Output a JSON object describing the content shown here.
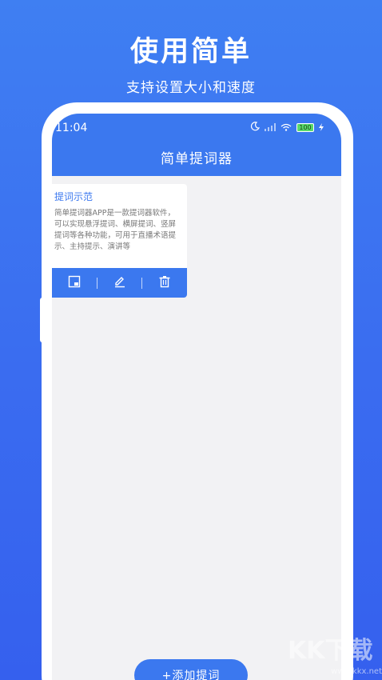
{
  "promo": {
    "headline": "使用简单",
    "subline": "支持设置大小和速度"
  },
  "status_bar": {
    "time": "11:04",
    "battery": "100"
  },
  "app": {
    "title": "简单提词器"
  },
  "card": {
    "title": "提词示范",
    "body": "简单提词器APP是一款提词器软件，可以实现悬浮提词、横屏提词、竖屏提词等各种功能，可用于直播术语提示、主持提示、演讲等"
  },
  "actions": {
    "add_label": "+添加提词"
  },
  "colors": {
    "primary": "#3b78ef",
    "background": "#f2f2f4",
    "gradient_top": "#3f7ff2",
    "gradient_bottom": "#3560ee"
  },
  "icons": {
    "card_actions": [
      "window-icon",
      "edit-icon",
      "trash-icon"
    ],
    "status": [
      "moon-icon",
      "signal-icon",
      "wifi-icon",
      "battery-icon",
      "charging-icon"
    ]
  },
  "watermark": {
    "brand": "KK下载",
    "url": "www.kkx.net"
  }
}
